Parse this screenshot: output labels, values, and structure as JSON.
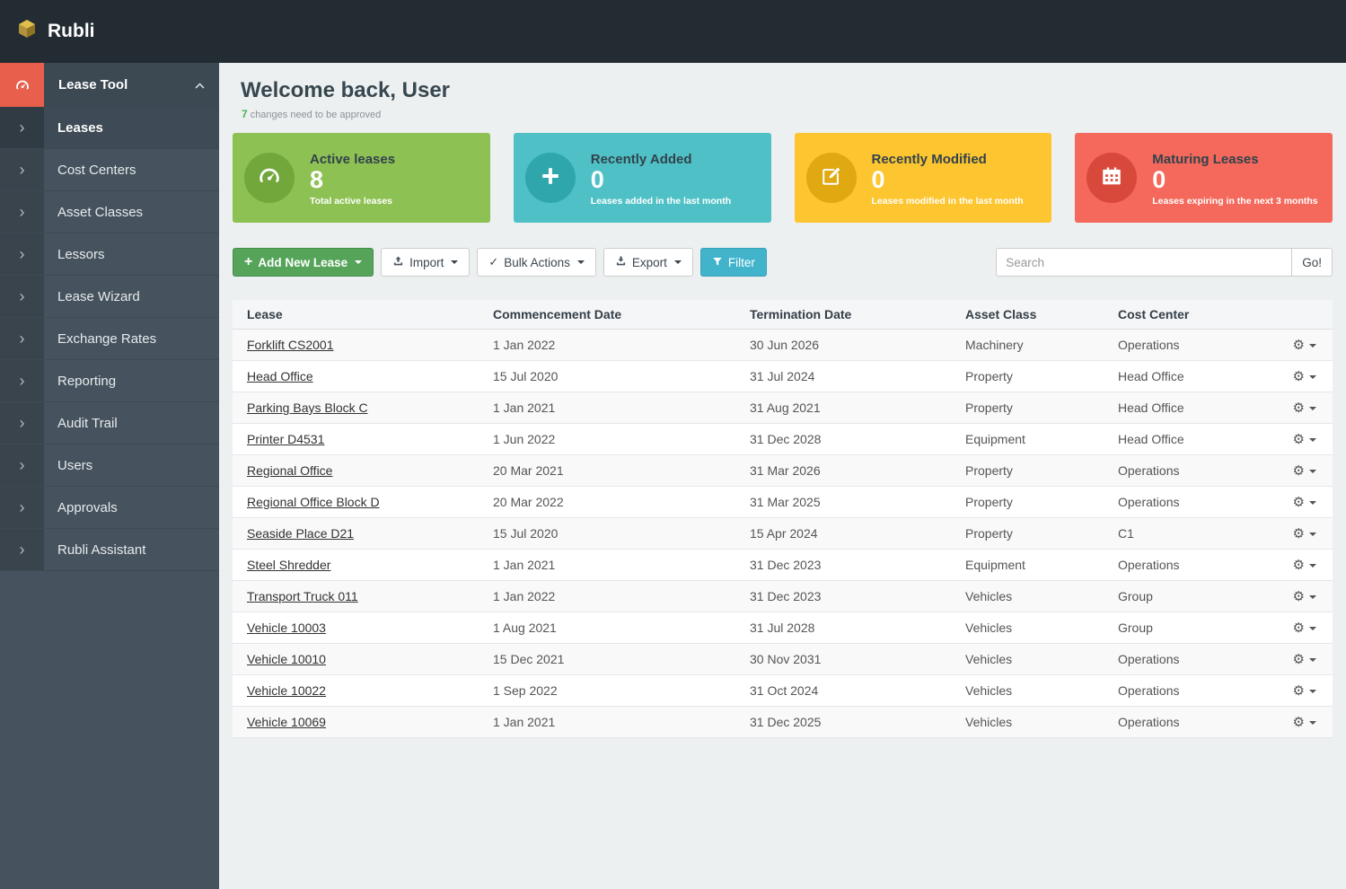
{
  "navbar": {
    "brand": "Rubli"
  },
  "sidebar": {
    "header": {
      "label": "Lease Tool",
      "icon": "gauge-icon"
    },
    "items": [
      {
        "label": "Leases",
        "active": true
      },
      {
        "label": "Cost Centers",
        "active": false
      },
      {
        "label": "Asset Classes",
        "active": false
      },
      {
        "label": "Lessors",
        "active": false
      },
      {
        "label": "Lease Wizard",
        "active": false
      },
      {
        "label": "Exchange Rates",
        "active": false
      },
      {
        "label": "Reporting",
        "active": false
      },
      {
        "label": "Audit Trail",
        "active": false
      },
      {
        "label": "Users",
        "active": false
      },
      {
        "label": "Approvals",
        "active": false
      },
      {
        "label": "Rubli Assistant",
        "active": false
      }
    ]
  },
  "welcome": {
    "title": "Welcome back, User",
    "badge_count": "7",
    "badge_text": "changes need to be approved"
  },
  "stat_cards": [
    {
      "title": "Active leases",
      "value": "8",
      "caption": "Total active leases",
      "bg": "#8ec153",
      "circle": "#72a73c",
      "icon": "gauge-icon"
    },
    {
      "title": "Recently Added",
      "value": "0",
      "caption": "Leases added in the last month",
      "bg": "#4fc1c6",
      "circle": "#2fa6ab",
      "icon": "plus-icon-large"
    },
    {
      "title": "Recently Modified",
      "value": "0",
      "caption": "Leases modified in the last month",
      "bg": "#fdc52f",
      "circle": "#e0a811",
      "icon": "edit-icon"
    },
    {
      "title": "Maturing Leases",
      "value": "0",
      "caption": "Leases expiring in the next 3 months",
      "bg": "#f4695b",
      "circle": "#d8493c",
      "icon": "calendar-icon"
    }
  ],
  "toolbar": {
    "add_new_lease": "Add New Lease",
    "import": "Import",
    "bulk_actions": "Bulk Actions",
    "export": "Export",
    "filter": "Filter",
    "search_placeholder": "Search",
    "go": "Go!"
  },
  "table": {
    "columns": [
      "Lease",
      "Commencement Date",
      "Termination Date",
      "Asset Class",
      "Cost Center"
    ],
    "rows": [
      {
        "lease": "Forklift CS2001",
        "commencement": "1 Jan 2022",
        "termination": "30 Jun 2026",
        "asset_class": "Machinery",
        "cost_center": "Operations"
      },
      {
        "lease": "Head Office",
        "commencement": "15 Jul 2020",
        "termination": "31 Jul 2024",
        "asset_class": "Property",
        "cost_center": "Head Office"
      },
      {
        "lease": "Parking Bays Block C",
        "commencement": "1 Jan 2021",
        "termination": "31 Aug 2021",
        "asset_class": "Property",
        "cost_center": "Head Office"
      },
      {
        "lease": "Printer D4531",
        "commencement": "1 Jun 2022",
        "termination": "31 Dec 2028",
        "asset_class": "Equipment",
        "cost_center": "Head Office"
      },
      {
        "lease": "Regional Office",
        "commencement": "20 Mar 2021",
        "termination": "31 Mar 2026",
        "asset_class": "Property",
        "cost_center": "Operations"
      },
      {
        "lease": "Regional Office Block D",
        "commencement": "20 Mar 2022",
        "termination": "31 Mar 2025",
        "asset_class": "Property",
        "cost_center": "Operations"
      },
      {
        "lease": "Seaside Place D21",
        "commencement": "15 Jul 2020",
        "termination": "15 Apr 2024",
        "asset_class": "Property",
        "cost_center": "C1"
      },
      {
        "lease": "Steel Shredder",
        "commencement": "1 Jan 2021",
        "termination": "31 Dec 2023",
        "asset_class": "Equipment",
        "cost_center": "Operations"
      },
      {
        "lease": "Transport Truck 011",
        "commencement": "1 Jan 2022",
        "termination": "31 Dec 2023",
        "asset_class": "Vehicles",
        "cost_center": "Group"
      },
      {
        "lease": "Vehicle 10003",
        "commencement": "1 Aug 2021",
        "termination": "31 Jul 2028",
        "asset_class": "Vehicles",
        "cost_center": "Group"
      },
      {
        "lease": "Vehicle 10010",
        "commencement": "15 Dec 2021",
        "termination": "30 Nov 2031",
        "asset_class": "Vehicles",
        "cost_center": "Operations"
      },
      {
        "lease": "Vehicle 10022",
        "commencement": "1 Sep 2022",
        "termination": "31 Oct 2024",
        "asset_class": "Vehicles",
        "cost_center": "Operations"
      },
      {
        "lease": "Vehicle 10069",
        "commencement": "1 Jan 2021",
        "termination": "31 Dec 2025",
        "asset_class": "Vehicles",
        "cost_center": "Operations"
      }
    ]
  }
}
